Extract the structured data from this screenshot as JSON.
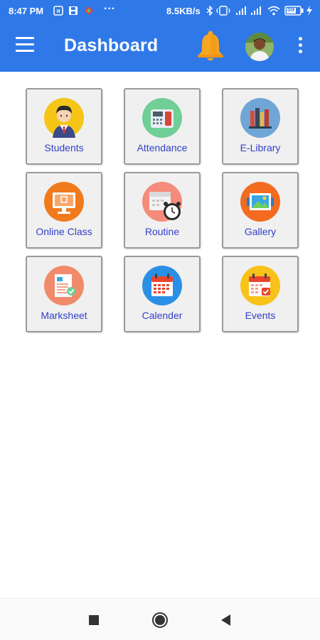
{
  "status_bar": {
    "time": "8:47 PM",
    "speed": "8.5KB/s",
    "battery": "59",
    "icons": [
      "sim-icon",
      "save-icon",
      "app-icon",
      "more-notifications-icon",
      "bluetooth-icon",
      "vibrate-icon",
      "signal-icon",
      "signal-icon",
      "wifi-icon",
      "battery-icon",
      "charging-icon"
    ]
  },
  "app_bar": {
    "title": "Dashboard",
    "menu_icon": "hamburger-menu-icon",
    "notification_icon": "bell-icon",
    "avatar": "user-avatar",
    "overflow_icon": "more-vertical-icon",
    "color": "#2f78e8",
    "bell_color": "#f7a721"
  },
  "tiles": [
    {
      "label": "Students",
      "icon": "student-icon",
      "icon_bg": "#f5c518"
    },
    {
      "label": "Attendance",
      "icon": "attendance-machine-icon",
      "icon_bg": "#6fcf97"
    },
    {
      "label": "E-Library",
      "icon": "books-icon",
      "icon_bg": "#6fa6d6"
    },
    {
      "label": "Online Class",
      "icon": "monitor-icon",
      "icon_bg": "#f07b1d"
    },
    {
      "label": "Routine",
      "icon": "calendar-clock-icon",
      "icon_bg": "#f58b7a"
    },
    {
      "label": "Gallery",
      "icon": "gallery-icon",
      "icon_bg": "#f36b21"
    },
    {
      "label": "Marksheet",
      "icon": "marksheet-icon",
      "icon_bg": "#f08a6a"
    },
    {
      "label": "Calender",
      "icon": "calendar-icon",
      "icon_bg": "#2b8fe6"
    },
    {
      "label": "Events",
      "icon": "events-calendar-icon",
      "icon_bg": "#f7c21a"
    }
  ],
  "label_color": "#3340c9",
  "nav": {
    "recents_icon": "square-icon",
    "home_icon": "circle-icon",
    "back_icon": "triangle-back-icon"
  }
}
